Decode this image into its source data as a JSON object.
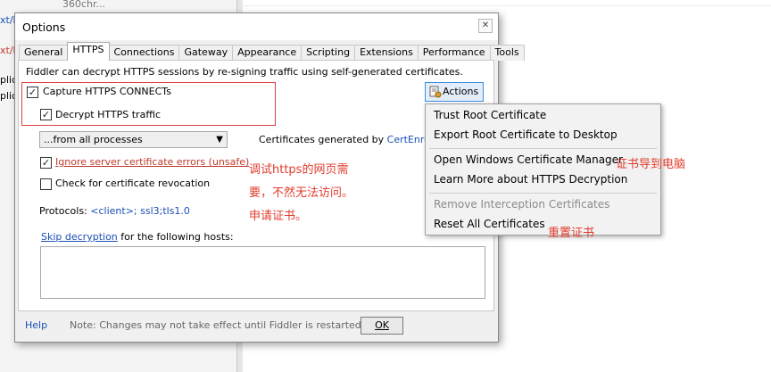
{
  "background": {
    "top_text": "360chr...",
    "left_fragments": [
      "xt/h",
      "xt/h",
      "plica",
      "plica"
    ]
  },
  "dialog": {
    "title": "Options",
    "close_glyph": "✕",
    "tabs": [
      "General",
      "HTTPS",
      "Connections",
      "Gateway",
      "Appearance",
      "Scripting",
      "Extensions",
      "Performance",
      "Tools"
    ],
    "active_tab": "HTTPS",
    "description": "Fiddler can decrypt HTTPS sessions by re-signing traffic using self-generated certificates.",
    "capture_label": "Capture HTTPS CONNECTs",
    "capture_checked": true,
    "decrypt_label": "Decrypt HTTPS traffic",
    "decrypt_checked": true,
    "process_filter": "...from all processes",
    "cert_gen_prefix": "Certificates generated by ",
    "cert_gen_link": "CertEnroll e",
    "ignore_errors_label": "Ignore server certificate errors (unsafe)",
    "ignore_errors_checked": true,
    "revocation_label": "Check for certificate revocation",
    "revocation_checked": false,
    "protocols_prefix": "Protocols: ",
    "protocols_value": "<client>; ssl3;tls1.0",
    "skip_link": "Skip decryption",
    "skip_suffix": " for the following hosts:",
    "hosts_value": "",
    "actions_label": "Actions",
    "help_label": "Help",
    "footer_note": "Note: Changes may not take effect until Fiddler is restarted.",
    "ok_label": "OK"
  },
  "actions_menu": {
    "items": [
      {
        "label": "Trust Root Certificate",
        "enabled": true
      },
      {
        "label": "Export Root Certificate to Desktop",
        "enabled": true
      },
      {
        "label": "Open Windows Certificate Manager",
        "enabled": true
      },
      {
        "label": "Learn More about HTTPS Decryption",
        "enabled": true
      },
      {
        "label": "Remove Interception Certificates",
        "enabled": false
      },
      {
        "label": "Reset All Certificates",
        "enabled": true
      }
    ]
  },
  "annotations": {
    "note_line1": "调试https的网页需",
    "note_line2": "要，不然无法访问。",
    "note_line3": "申请证书。",
    "export_note": "证书导到电脑",
    "reset_note": "重置证书",
    "color": "#e23b2c"
  }
}
